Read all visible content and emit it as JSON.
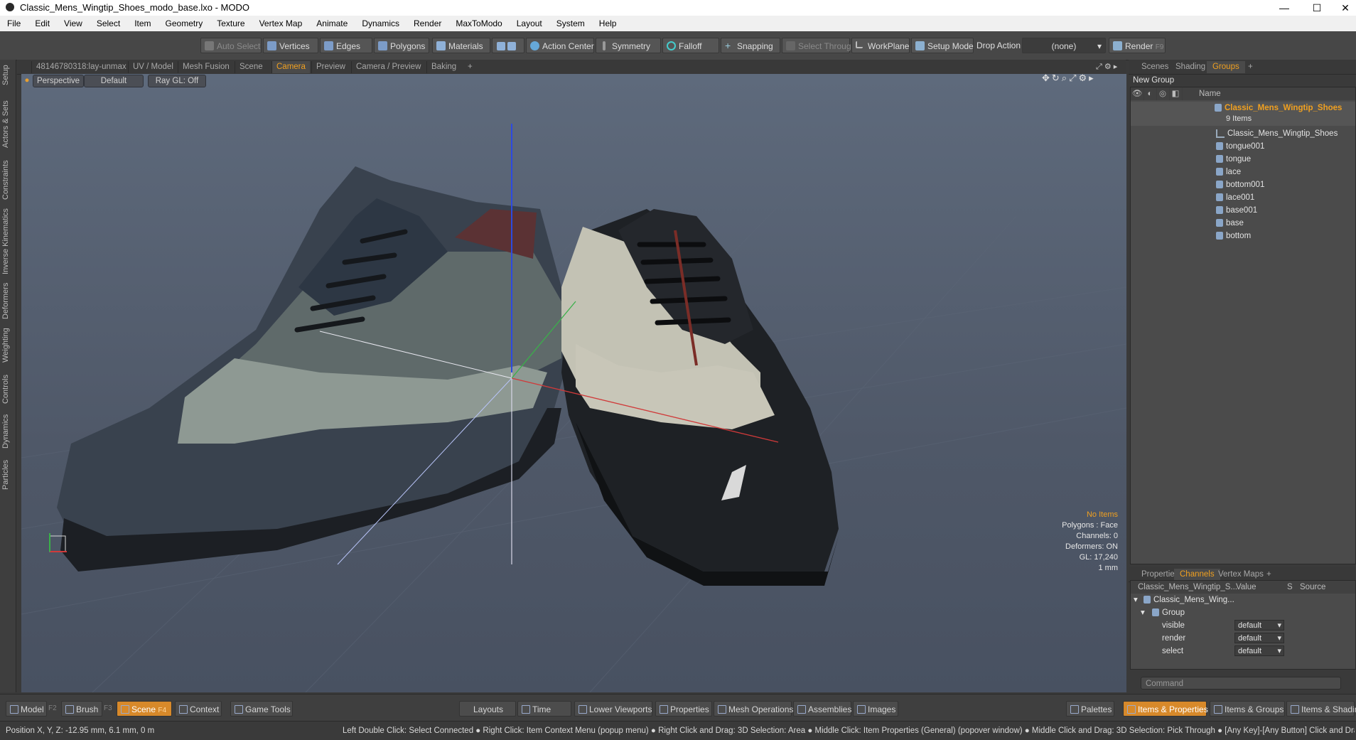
{
  "window": {
    "title": "Classic_Mens_Wingtip_Shoes_modo_base.lxo - MODO",
    "controls": [
      "—",
      "☐",
      "✕"
    ]
  },
  "menu": [
    "File",
    "Edit",
    "View",
    "Select",
    "Item",
    "Geometry",
    "Texture",
    "Vertex Map",
    "Animate",
    "Dynamics",
    "Render",
    "MaxToModo",
    "Layout",
    "System",
    "Help"
  ],
  "toolbar": {
    "auto_select": "Auto Select",
    "vertices": "Vertices",
    "edges": "Edges",
    "polygons": "Polygons",
    "materials": "Materials",
    "action_center": "Action Center",
    "symmetry": "Symmetry",
    "falloff": "Falloff",
    "snapping": "Snapping",
    "select_through": "Select Through",
    "workplane": "WorkPlane",
    "setup_mode": "Setup Mode",
    "drop_action": "Drop Action",
    "drop_value": "(none)",
    "render": "Render",
    "render_key": "F9"
  },
  "left_tabs": [
    "Setup",
    "Actors & Sets",
    "Constraints",
    "Inverse Kinematics",
    "Deformers",
    "Weighting",
    "Controls",
    "Dynamics",
    "Particles"
  ],
  "viewport_tabs": [
    "48146780318:lay-unmax",
    "UV / Model",
    "Mesh Fusion",
    "Scene",
    "Camera",
    "Preview",
    "Camera / Preview",
    "Baking",
    "+"
  ],
  "viewport_header": {
    "view": "Perspective",
    "style": "Default",
    "raygl": "Ray GL: Off"
  },
  "hud": {
    "items": "No Items",
    "polygons": "Polygons : Face",
    "channels": "Channels: 0",
    "deformers": "Deformers: ON",
    "gl": "GL: 17,240",
    "unit": "1 mm"
  },
  "right_tabs": [
    "Scenes",
    "Shading",
    "Groups",
    "+"
  ],
  "groups": {
    "new_group": "New Group",
    "column_name": "Name",
    "root": "Classic_Mens_Wingtip_Shoes",
    "root_count": "9 Items",
    "children": [
      "Classic_Mens_Wingtip_Shoes",
      "tongue001",
      "tongue",
      "lace",
      "bottom001",
      "lace001",
      "base001",
      "base",
      "bottom"
    ]
  },
  "lower_tabs": [
    "Properties",
    "Channels",
    "Vertex Maps",
    "+"
  ],
  "channels": {
    "col_name": "Classic_Mens_Wingtip_S...",
    "col_value": "Value",
    "col_s": "S",
    "col_source": "Source",
    "item": "Classic_Mens_Wing...",
    "group": "Group",
    "rows": [
      {
        "name": "visible",
        "value": "default"
      },
      {
        "name": "render",
        "value": "default"
      },
      {
        "name": "select",
        "value": "default"
      }
    ]
  },
  "command_placeholder": "Command",
  "bottom": {
    "model": "Model",
    "model_key": "F2",
    "brush": "Brush",
    "brush_key": "F3",
    "scene": "Scene",
    "scene_key": "F4",
    "context": "Context",
    "game_tools": "Game Tools",
    "layouts": "Layouts",
    "time": "Time",
    "lower_viewports": "Lower Viewports",
    "properties": "Properties",
    "mesh_operations": "Mesh Operations",
    "assemblies": "Assemblies",
    "images": "Images",
    "palettes": "Palettes",
    "items_properties": "Items & Properties",
    "items_groups": "Items & Groups",
    "items_shading": "Items & Shading"
  },
  "status": {
    "position": "Position X, Y, Z:   -12.95 mm, 6.1 mm, 0 m",
    "hints": "Left Double Click: Select Connected ● Right Click: Item Context Menu (popup menu) ● Right Click and Drag: 3D Selection: Area ● Middle Click: Item Properties (General) (popover window) ● Middle Click and Drag: 3D Selection: Pick Through ● [Any Key]-[Any Button] Click and Drag: dragDrop"
  },
  "colors": {
    "accent": "#f0a020",
    "active_button": "#d7892a",
    "viewport_top": "#5e6a7c",
    "viewport_bottom": "#485161"
  }
}
